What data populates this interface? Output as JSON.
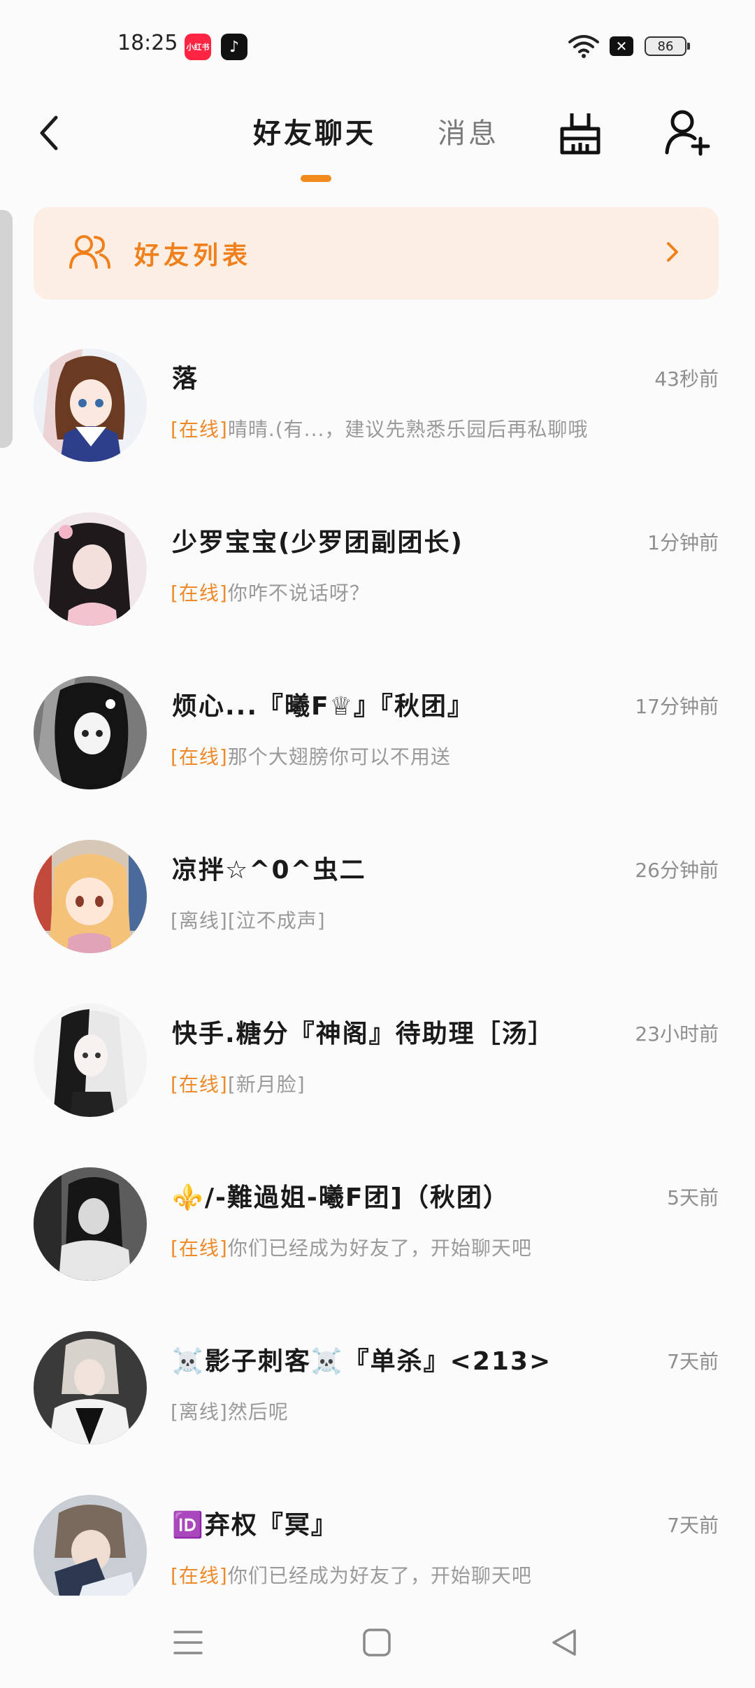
{
  "status_bar": {
    "time": "18:25",
    "apps": [
      "xiaohongshu-icon",
      "douyin-icon"
    ],
    "battery": "86"
  },
  "header": {
    "tabs": [
      {
        "label": "好友聊天",
        "active": true
      },
      {
        "label": "消息",
        "active": false
      }
    ],
    "accent_color": "#f28b1e"
  },
  "friends_banner": {
    "label": "好友列表"
  },
  "chats": [
    {
      "name": "落",
      "time": "43秒前",
      "status": "[在线]",
      "online": true,
      "preview": "晴晴.(有...，建议先熟悉乐园后再私聊哦"
    },
    {
      "name": "少罗宝宝(少罗团副团长)",
      "time": "1分钟前",
      "status": "[在线]",
      "online": true,
      "preview": "你咋不说话呀？"
    },
    {
      "name": "烦心...『曦F♕』『秋团』",
      "time": "17分钟前",
      "status": "[在线]",
      "online": true,
      "preview": "那个大翅膀你可以不用送"
    },
    {
      "name": "凉拌☆^0^虫二",
      "time": "26分钟前",
      "status": "[离线]",
      "online": false,
      "preview": "[泣不成声]"
    },
    {
      "name": "快手.糖分『神阁』待助理［汤］",
      "time": "23小时前",
      "status": "[在线]",
      "online": true,
      "preview": "[新月脸]"
    },
    {
      "name": "⚜️/-難過姐-曦F团]（秋团）",
      "time": "5天前",
      "status": "[在线]",
      "online": true,
      "preview": "你们已经成为好友了，开始聊天吧"
    },
    {
      "name": "☠️影子刺客☠️『单杀』<213>",
      "time": "7天前",
      "status": "[离线]",
      "online": false,
      "preview": "然后呢"
    },
    {
      "name": "🆔弃权『冥』",
      "time": "7天前",
      "status": "[在线]",
      "online": true,
      "preview": "你们已经成为好友了，开始聊天吧"
    }
  ],
  "nav_bar": {
    "buttons": [
      "menu-icon",
      "home-square-icon",
      "back-triangle-icon"
    ]
  }
}
